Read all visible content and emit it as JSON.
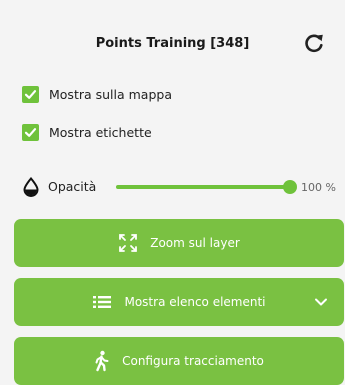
{
  "header": {
    "title": "Points Training [348]"
  },
  "checkboxes": [
    {
      "label": "Mostra sulla mappa",
      "checked": true
    },
    {
      "label": "Mostra etichette",
      "checked": true
    }
  ],
  "opacity": {
    "label": "Opacità",
    "value": 100,
    "value_text": "100 %"
  },
  "buttons": {
    "zoom": {
      "label": "Zoom sul layer",
      "icon": "expand-arrows-icon"
    },
    "list": {
      "label": "Mostra elenco elementi",
      "icon": "list-icon",
      "trailing_icon": "chevron-down-icon"
    },
    "tracking": {
      "label": "Configura tracciamento",
      "icon": "walking-person-icon"
    }
  },
  "colors": {
    "accent": "#7ac142",
    "checkbox": "#6fc23b",
    "background": "#f4f4f4"
  }
}
